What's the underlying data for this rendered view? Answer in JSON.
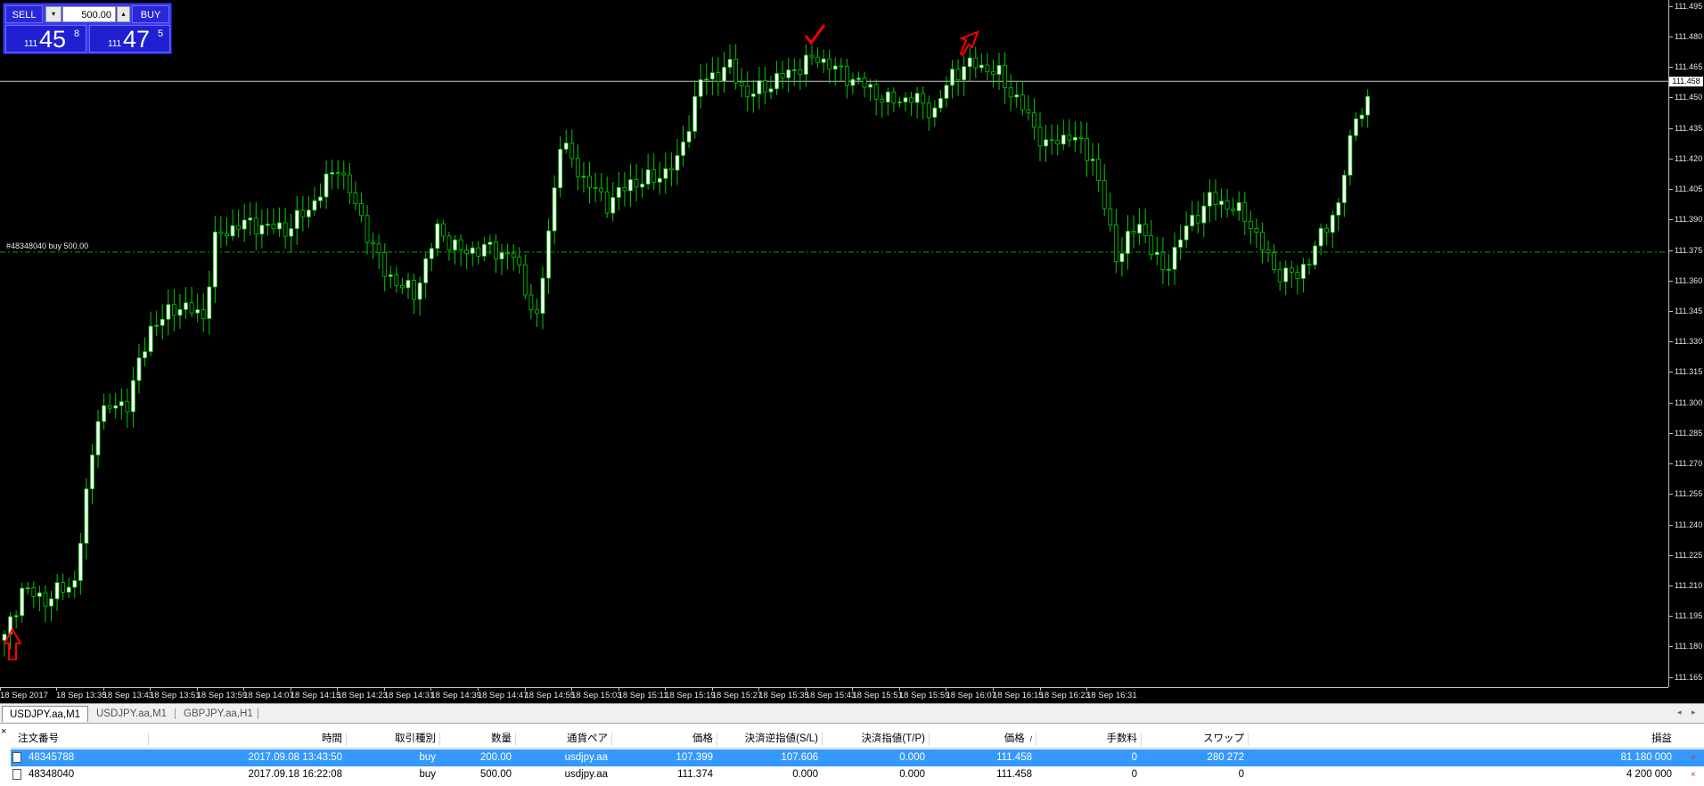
{
  "chart": {
    "symbol_tab_active": "USDJPY.aa,M1",
    "current_price": "111.458",
    "order_line_label": "#48348040 buy 500.00",
    "order_price": 111.374,
    "price_axis": [
      "111.495",
      "111.480",
      "111.465",
      "111.450",
      "111.435",
      "111.420",
      "111.405",
      "111.390",
      "111.375",
      "111.360",
      "111.345",
      "111.330",
      "111.315",
      "111.300",
      "111.285",
      "111.270",
      "111.255",
      "111.240",
      "111.225",
      "111.210",
      "111.195",
      "111.180",
      "111.165"
    ],
    "time_axis": [
      "18 Sep 2017",
      "18 Sep 13:35",
      "18 Sep 13:43",
      "18 Sep 13:51",
      "18 Sep 13:59",
      "18 Sep 14:07",
      "18 Sep 14:15",
      "18 Sep 14:23",
      "18 Sep 14:31",
      "18 Sep 14:39",
      "18 Sep 14:47",
      "18 Sep 14:55",
      "18 Sep 15:03",
      "18 Sep 15:11",
      "18 Sep 15:19",
      "18 Sep 15:27",
      "18 Sep 15:35",
      "18 Sep 15:43",
      "18 Sep 15:51",
      "18 Sep 15:59",
      "18 Sep 16:07",
      "18 Sep 16:15",
      "18 Sep 16:23",
      "18 Sep 16:31"
    ],
    "colors": {
      "background": "#000000",
      "bull": "#ffffff",
      "bear": "#000000",
      "wick": "#00cc00",
      "order_line": "#00aa00",
      "marker": "#ff0000"
    }
  },
  "chart_data": {
    "type": "candlestick",
    "title": "",
    "x_unit": "minutes",
    "ylim": [
      111.16,
      111.498
    ],
    "close_path": [
      [
        0,
        111.184
      ],
      [
        3,
        111.208
      ],
      [
        7,
        111.203
      ],
      [
        12,
        111.212
      ],
      [
        16,
        111.295
      ],
      [
        21,
        111.3
      ],
      [
        25,
        111.337
      ],
      [
        30,
        111.348
      ],
      [
        34,
        111.342
      ],
      [
        36,
        111.38
      ],
      [
        40,
        111.388
      ],
      [
        44,
        111.387
      ],
      [
        48,
        111.385
      ],
      [
        52,
        111.395
      ],
      [
        57,
        111.417
      ],
      [
        61,
        111.39
      ],
      [
        65,
        111.364
      ],
      [
        70,
        111.353
      ],
      [
        74,
        111.385
      ],
      [
        78,
        111.374
      ],
      [
        82,
        111.376
      ],
      [
        87,
        111.372
      ],
      [
        91,
        111.34
      ],
      [
        95,
        111.428
      ],
      [
        99,
        111.41
      ],
      [
        103,
        111.398
      ],
      [
        107,
        111.408
      ],
      [
        111,
        111.41
      ],
      [
        115,
        111.418
      ],
      [
        119,
        111.458
      ],
      [
        124,
        111.465
      ],
      [
        127,
        111.451
      ],
      [
        131,
        111.457
      ],
      [
        135,
        111.464
      ],
      [
        139,
        111.47
      ],
      [
        143,
        111.462
      ],
      [
        147,
        111.456
      ],
      [
        151,
        111.448
      ],
      [
        155,
        111.45
      ],
      [
        159,
        111.443
      ],
      [
        162,
        111.462
      ],
      [
        166,
        111.467
      ],
      [
        170,
        111.461
      ],
      [
        174,
        111.445
      ],
      [
        178,
        111.426
      ],
      [
        182,
        111.432
      ],
      [
        186,
        111.42
      ],
      [
        190,
        111.372
      ],
      [
        194,
        111.388
      ],
      [
        198,
        111.364
      ],
      [
        202,
        111.386
      ],
      [
        206,
        111.4
      ],
      [
        210,
        111.396
      ],
      [
        213,
        111.388
      ],
      [
        217,
        111.365
      ],
      [
        221,
        111.362
      ],
      [
        224,
        111.376
      ],
      [
        228,
        111.398
      ],
      [
        231,
        111.442
      ],
      [
        233,
        111.447
      ]
    ],
    "annotations": [
      "buy arrow at 13:28",
      "check marker near 15:18",
      "sell arrow near 15:36"
    ]
  },
  "trade_panel": {
    "sell_label": "SELL",
    "buy_label": "BUY",
    "lot_value": "500.00",
    "dropdown_glyph": "▾",
    "up_glyph": "▴",
    "bid_prefix": "111",
    "bid_big": "45",
    "bid_sup": "8",
    "ask_prefix": "111",
    "ask_big": "47",
    "ask_sup": "5",
    "colors": {
      "panel": "#2020d0"
    }
  },
  "tabs": [
    "USDJPY.aa,M1",
    "USDJPY.aa,M1",
    "GBPJPY.aa,H1"
  ],
  "tab_scroll": {
    "left": "◂",
    "right": "▸"
  },
  "terminal": {
    "close_glyph": "×",
    "sort_glyph": "/",
    "headers": [
      "注文番号",
      "時間",
      "取引種別",
      "数量",
      "通貨ペア",
      "価格",
      "決済逆指値(S/L)",
      "決済指値(T/P)",
      "価格",
      "手数料",
      "スワップ",
      "損益"
    ],
    "rows": [
      [
        "48345788",
        "2017.09.08 13:43:50",
        "buy",
        "200.00",
        "usdjpy.aa",
        "107.399",
        "107.606",
        "0.000",
        "111.458",
        "0",
        "280 272",
        "81 180 000"
      ],
      [
        "48348040",
        "2017.09.18 16:22:08",
        "buy",
        "500.00",
        "usdjpy.aa",
        "111.374",
        "0.000",
        "0.000",
        "111.458",
        "0",
        "0",
        "4 200 000"
      ]
    ],
    "row_close_glyph": "×",
    "selected_row_color": "#3399ff"
  }
}
